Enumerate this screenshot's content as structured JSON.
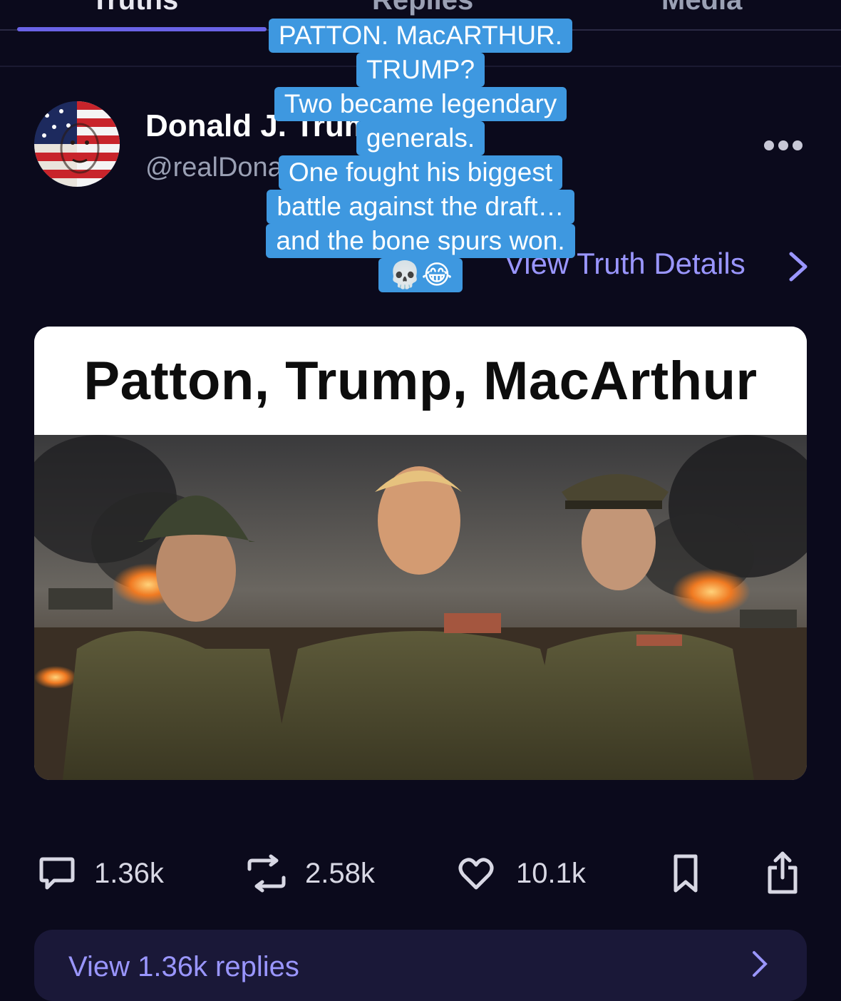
{
  "tabs": [
    {
      "label": "Truths"
    },
    {
      "label": "Replies"
    },
    {
      "label": "Media"
    }
  ],
  "post": {
    "author_name": "Donald J. Trump",
    "author_handle": "@realDonaldTrump",
    "more_icon": "more-horizontal-icon",
    "view_details_label": "View Truth Details",
    "card_title": "Patton, Trump, MacArthur"
  },
  "caption": {
    "lines": [
      "PATTON. MacARTHUR.",
      "TRUMP?",
      "Two became legendary",
      "generals.",
      "One fought his biggest",
      "battle against the draft…",
      "and the bone spurs won.",
      "💀😂"
    ],
    "background": "#3e98e0"
  },
  "actions": {
    "replies": "1.36k",
    "retruths": "2.58k",
    "likes": "10.1k",
    "icons": [
      "comment-icon",
      "retruth-icon",
      "heart-icon",
      "bookmark-icon",
      "share-icon"
    ]
  },
  "view_replies": {
    "label": "View 1.36k replies"
  },
  "colors": {
    "background": "#0b0a1c",
    "accent": "#6a63e6",
    "link": "#9a96ff"
  }
}
